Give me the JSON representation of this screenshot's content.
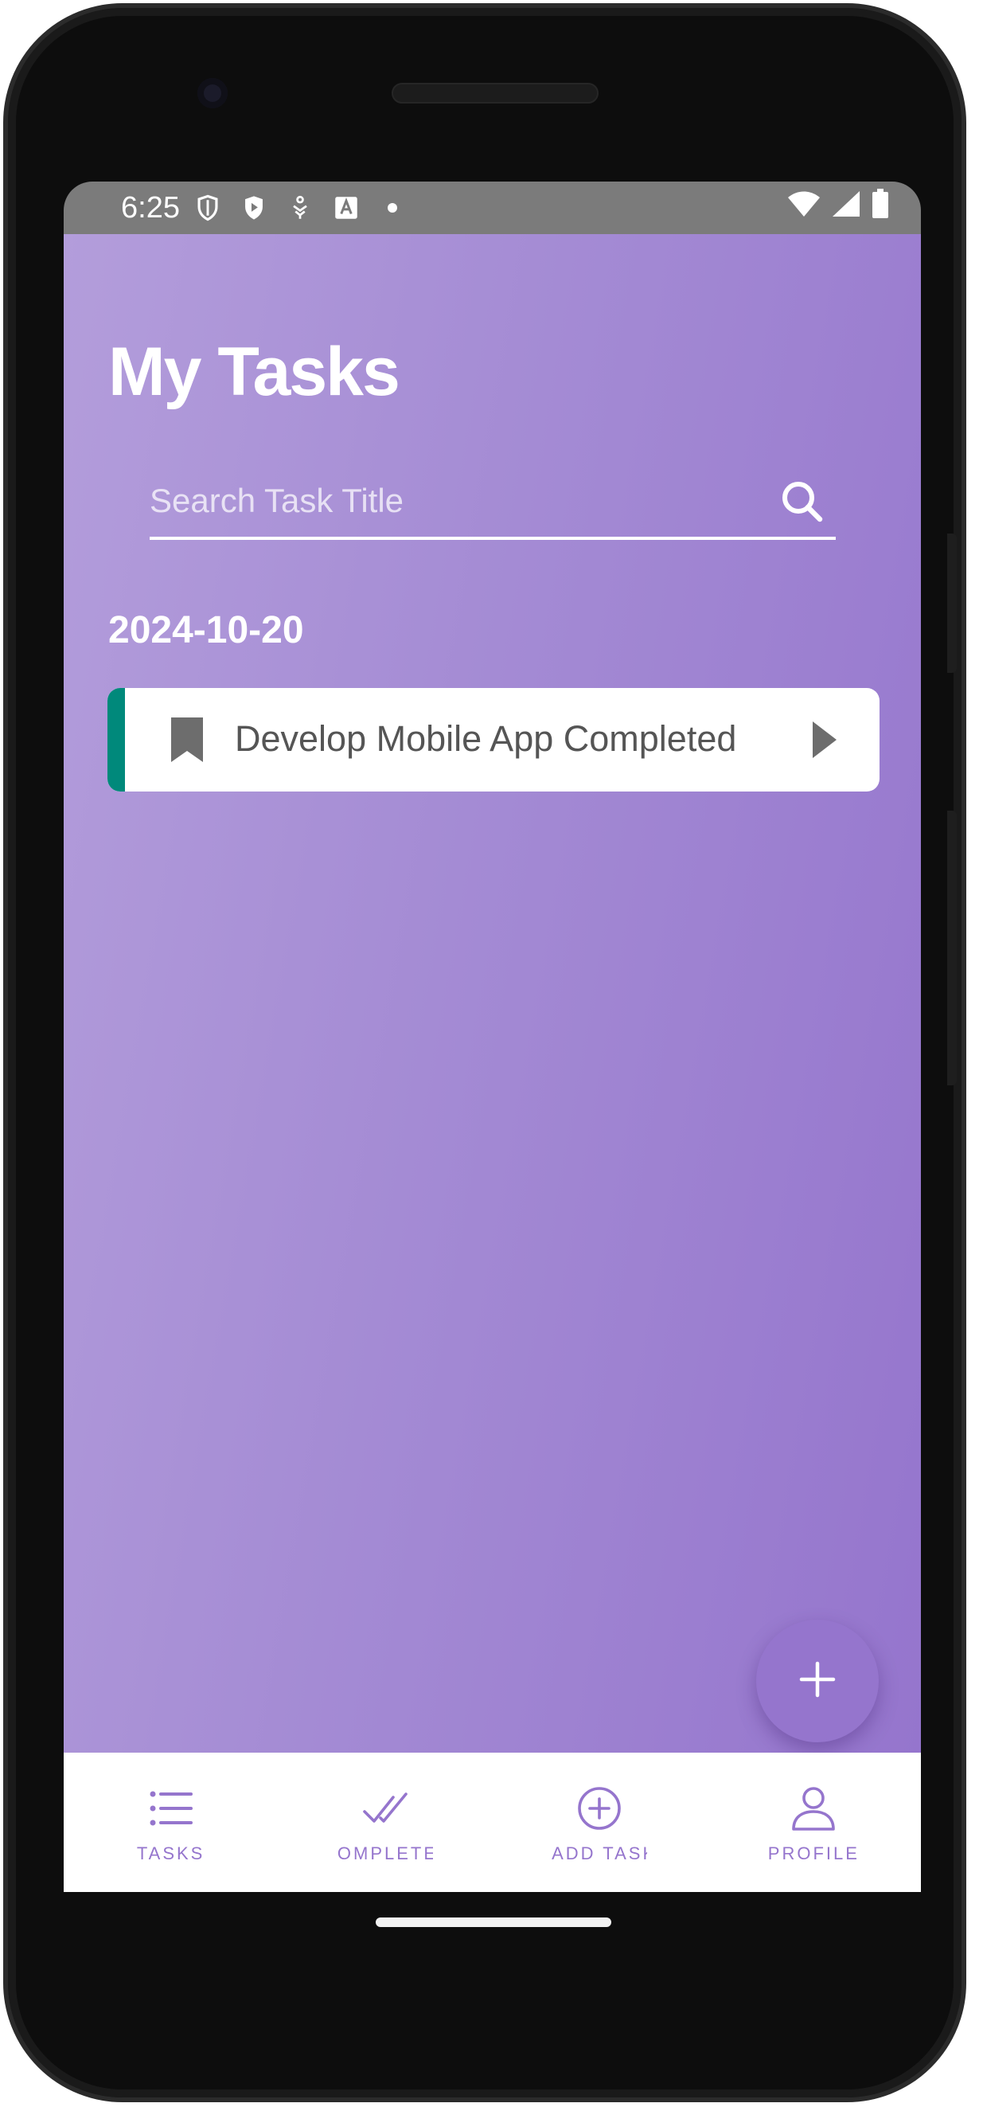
{
  "status_bar": {
    "time": "6:25",
    "icons": [
      "shield-outline-icon",
      "shield-play-icon",
      "accessibility-icon",
      "text-a-icon",
      "notification-dot-icon"
    ],
    "right_icons": [
      "wifi-icon",
      "signal-icon",
      "battery-icon"
    ]
  },
  "header": {
    "title": "My Tasks"
  },
  "search": {
    "placeholder": "Search Task Title",
    "value": ""
  },
  "task_groups": [
    {
      "date": "2024-10-20",
      "tasks": [
        {
          "title": "Develop Mobile App Completed",
          "accent_color": "#00897b",
          "icon": "bookmark-icon"
        }
      ]
    }
  ],
  "fab": {
    "icon": "plus-icon"
  },
  "bottom_nav": {
    "items": [
      {
        "label": "TASKS",
        "icon": "list-icon"
      },
      {
        "label": "OMPLETE",
        "icon": "double-check-icon"
      },
      {
        "label": "ADD TASK",
        "icon": "add-circle-icon"
      },
      {
        "label": "PROFILE",
        "icon": "person-icon"
      }
    ]
  },
  "colors": {
    "gradient_start": "#b39ddb",
    "gradient_end": "#9575cd",
    "accent": "#9575cd",
    "task_accent": "#00897b",
    "status_bar": "#7b7b7b"
  }
}
